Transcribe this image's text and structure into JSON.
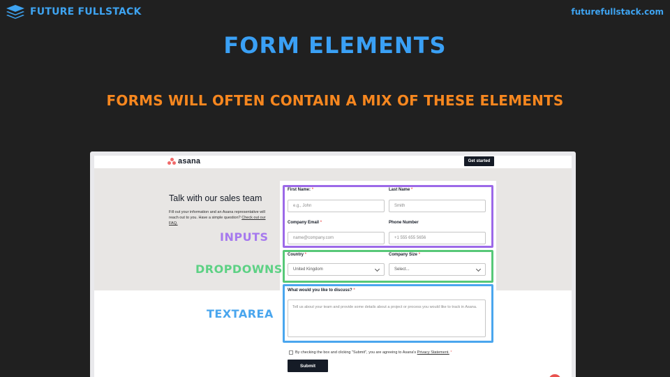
{
  "brand": {
    "name": "FUTURE FULLSTACK",
    "url": "futurefullstack.com",
    "color": "#3ea3f0"
  },
  "slide": {
    "title": "FORM ELEMENTS",
    "subtitle": "FORMS WILL OFTEN CONTAIN A MIX OF THESE ELEMENTS"
  },
  "annotations": {
    "inputs": "INPUTS",
    "dropdowns": "DROPDOWNS",
    "textarea": "TEXTAREA"
  },
  "asana": {
    "logo": "asana",
    "cta": "Get started",
    "heading": "Talk with our sales team",
    "description": "Fill out your information and an Asana representative will reach out to you. Have a simple question?",
    "faq_link": "Check out our FAQ."
  },
  "form": {
    "first_name": {
      "label": "First Name:",
      "placeholder": "e.g., John"
    },
    "last_name": {
      "label": "Last Name",
      "placeholder": "Smith"
    },
    "company_email": {
      "label": "Company Email",
      "placeholder": "name@company.com"
    },
    "phone": {
      "label": "Phone Number",
      "placeholder": "+1 555 655 5656"
    },
    "country": {
      "label": "Country",
      "value": "United Kingdom"
    },
    "company_size": {
      "label": "Company Size",
      "value": "Select..."
    },
    "discuss": {
      "label": "What would you like to discuss?",
      "placeholder": "Tell us about your team and provide some details about a project or process you would like to track in Asana."
    },
    "required_mark": "*",
    "consent": {
      "text": "By checking the box and clicking \"Submit\", you are agreeing to Asana's",
      "link": "Privacy Statement."
    },
    "submit": "Submit"
  },
  "colors": {
    "inputs_highlight": "#9c69e8",
    "dropdowns_highlight": "#57c878",
    "textarea_highlight": "#4aa6ee",
    "title": "#3aa0f5",
    "subtitle": "#f7871f"
  }
}
